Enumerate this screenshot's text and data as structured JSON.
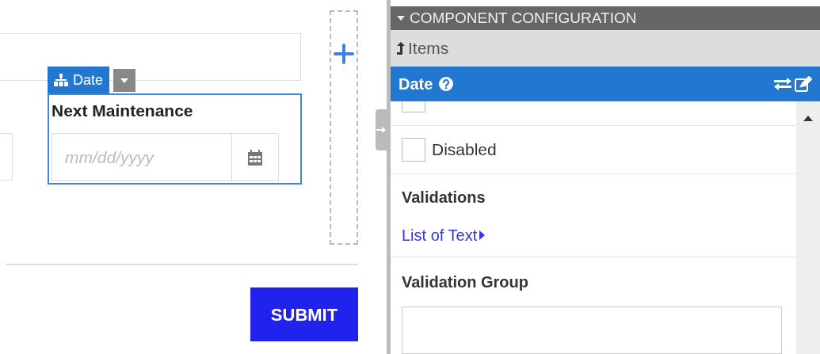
{
  "canvas": {
    "component_tag": "Date",
    "field_label": "Next Maintenance",
    "date_placeholder": "mm/dd/yyyy",
    "submit_button": "SUBMIT"
  },
  "panel": {
    "title": "COMPONENT CONFIGURATION",
    "expanded": true,
    "breadcrumb": "Items",
    "component_name": "Date",
    "options": [
      {
        "kind": "checkbox",
        "checked": false
      },
      {
        "kind": "checkbox",
        "label": "Disabled",
        "checked": false
      },
      {
        "kind": "link",
        "heading": "Validations",
        "link": "List of Text"
      },
      {
        "kind": "textbox",
        "heading": "Validation Group"
      }
    ]
  }
}
